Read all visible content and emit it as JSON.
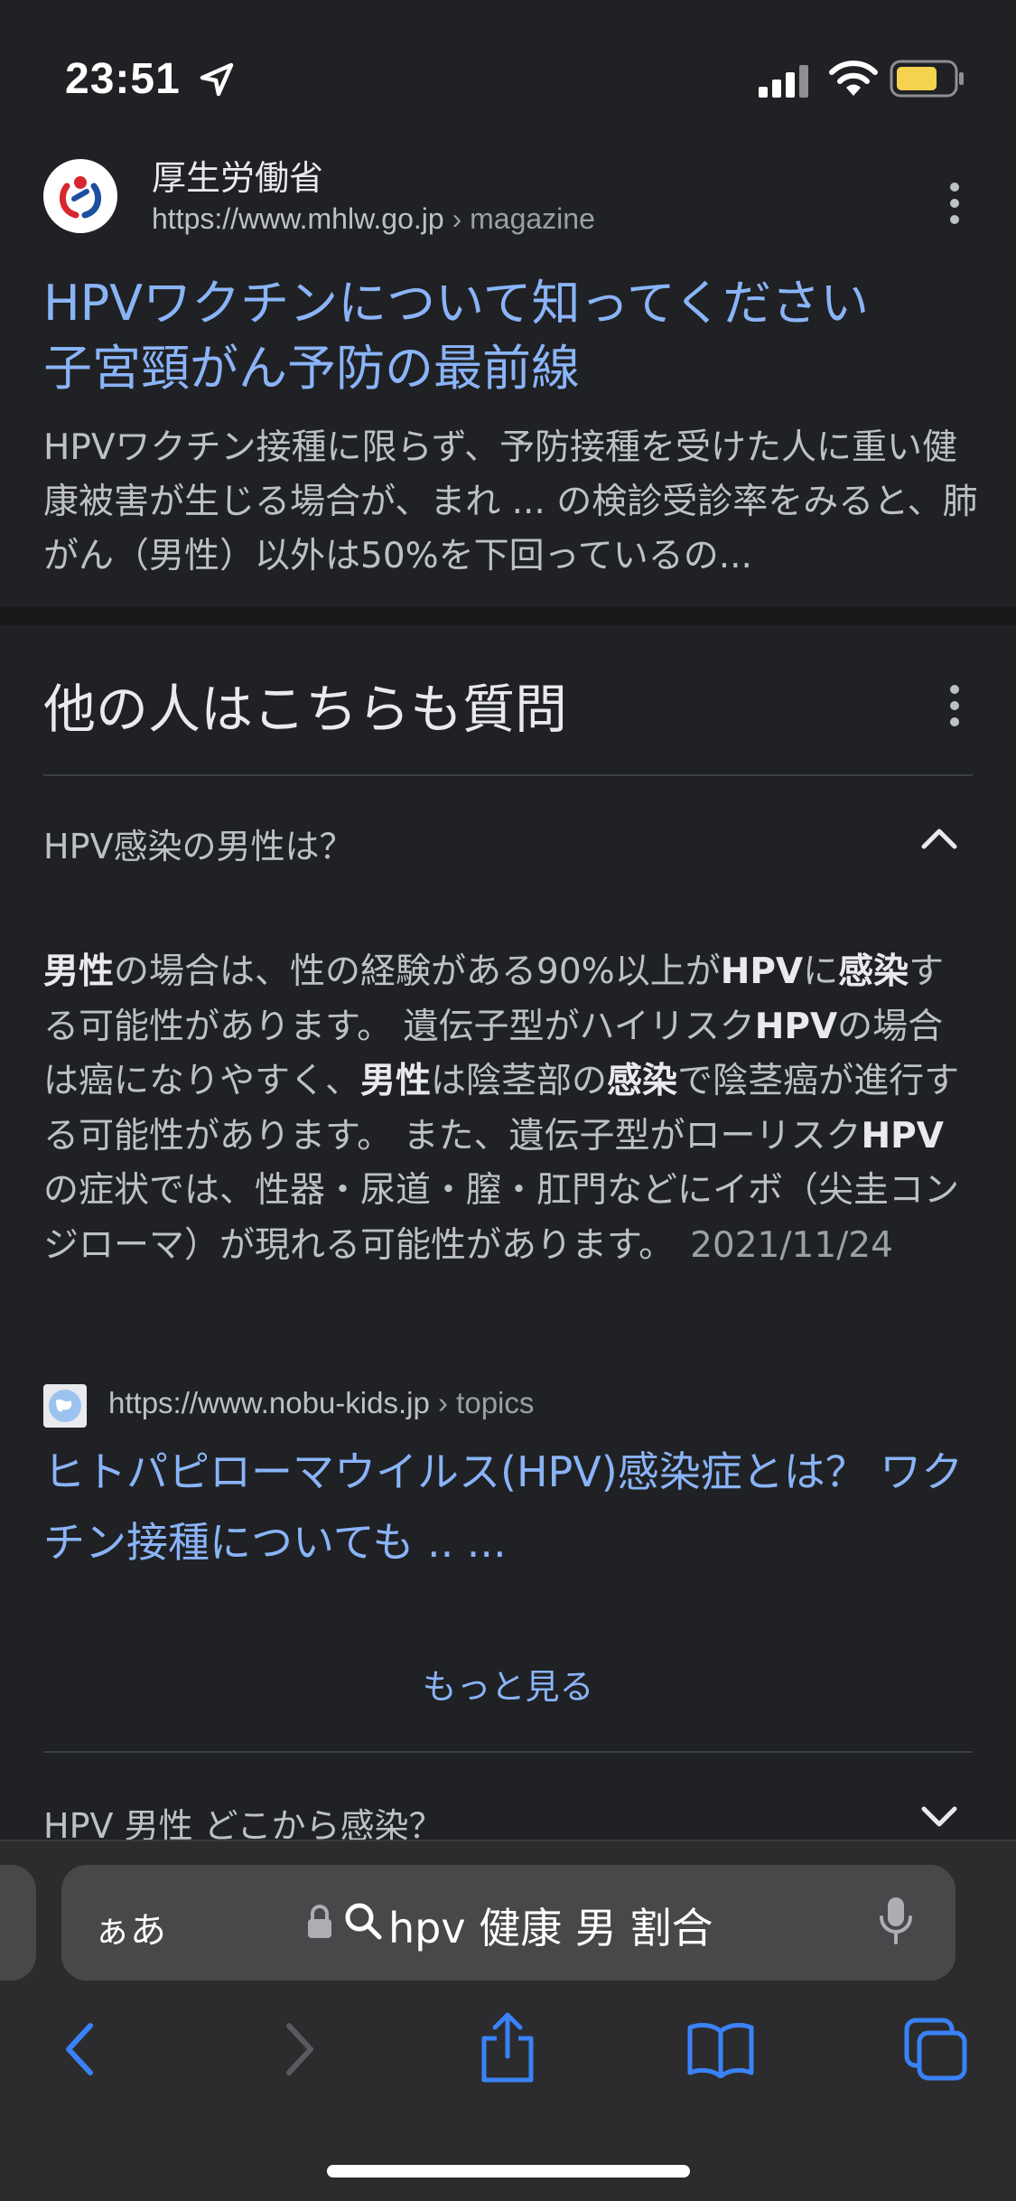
{
  "status_bar": {
    "time": "23:51",
    "battery_color": "#f5d34f"
  },
  "result": {
    "site_name": "厚生労働省",
    "url": "https://www.mhlw.go.jp",
    "url_crumb": "› magazine",
    "title_line1": "HPVワクチンについて知ってください",
    "title_line2": "子宮頸がん予防の最前線",
    "snippet": "HPVワクチン接種に限らず、予防接種を受けた人に重い健康被害が生じる場合が、まれ ... の検診受診率をみると、肺がん（男性）以外は50%を下回っているの..."
  },
  "paa": {
    "heading": "他の人はこちらも質問",
    "question1": "HPV感染の男性は？",
    "answer": {
      "s1": "男性",
      "s2": "の場合は、性の経験がある90%以上が",
      "s3": "HPV",
      "s4": "に",
      "s5": "感染",
      "s6": "する可能性があります。 遺伝子型がハイリスク",
      "s7": "HPV",
      "s8": "の場合は癌になりやすく、",
      "s9": "男性",
      "s10": "は陰茎部の",
      "s11": "感染",
      "s12": "で陰茎癌が進行する可能性があります。 また、遺伝子型がローリスク",
      "s13": "HPV",
      "s14": "の症状では、性器・尿道・膣・肛門などにイボ（尖圭コンジローマ）が現れる可能性があります。",
      "date": "2021/11/24"
    },
    "source_url": "https://www.nobu-kids.jp",
    "source_crumb": "› topics",
    "source_title": "ヒトパピローマウイルス(HPV)感染症とは？ ワクチン接種についても .. ...",
    "more_label": "もっと見る",
    "question2": "HPV 男性 どこから感染？"
  },
  "browser": {
    "aa_label": "ぁあ",
    "query": "hpv 健康 男 割合",
    "accent": "#3a82f7"
  }
}
